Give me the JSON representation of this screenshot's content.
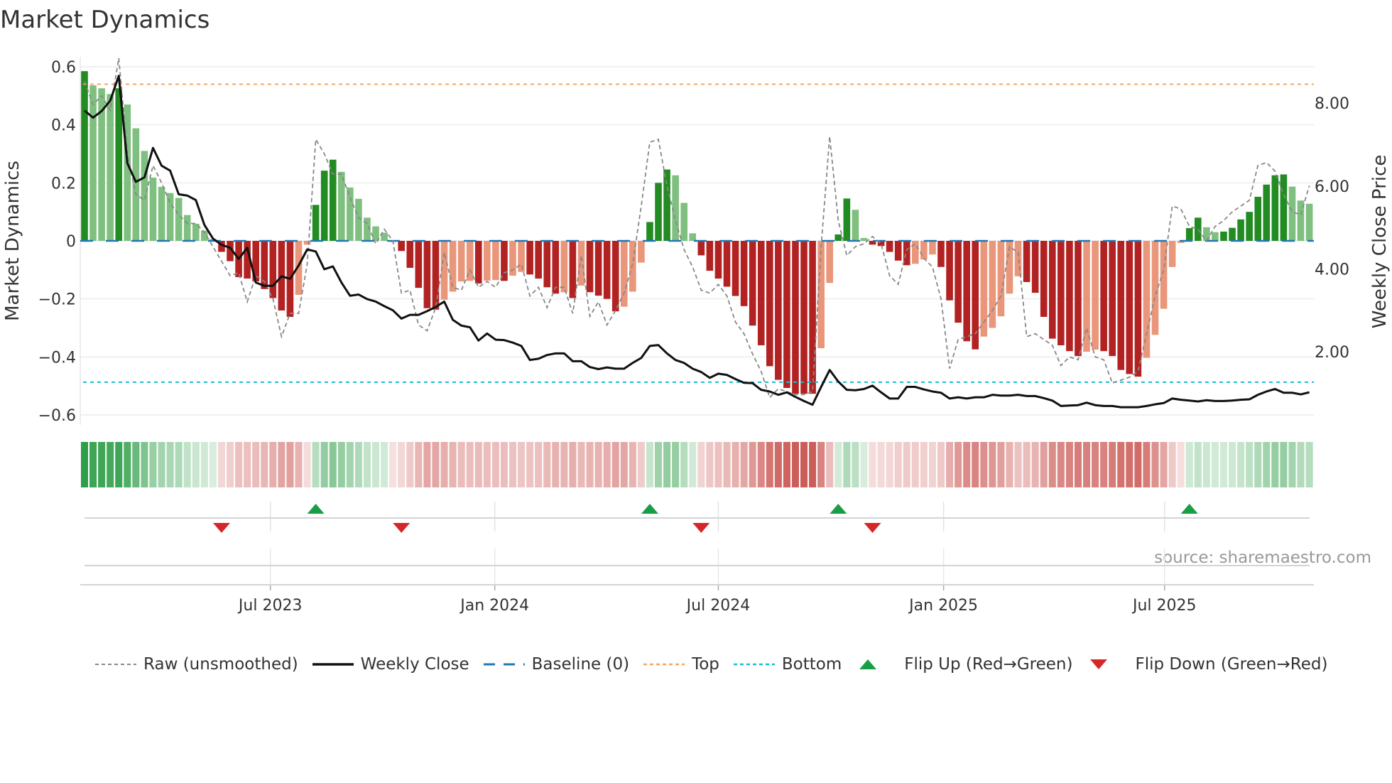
{
  "chart_data": {
    "type": "bar",
    "title": "Market Dynamics",
    "ylabel": "Market Dynamics",
    "y2label": "Weekly Close Price",
    "ylim": [
      -0.62,
      0.62
    ],
    "y2lim": [
      0.0,
      9.3
    ],
    "yticks": [
      {
        "v": 0.6,
        "label": "0.6"
      },
      {
        "v": 0.4,
        "label": "0.4"
      },
      {
        "v": 0.2,
        "label": "0.2"
      },
      {
        "v": 0,
        "label": "0"
      },
      {
        "v": -0.2,
        "label": "−0.2"
      },
      {
        "v": -0.4,
        "label": "−0.4"
      },
      {
        "v": -0.6,
        "label": "−0.6"
      }
    ],
    "y2ticks": [
      {
        "v": 8,
        "label": "8.00"
      },
      {
        "v": 6,
        "label": "6.00"
      },
      {
        "v": 4,
        "label": "4.00"
      },
      {
        "v": 2,
        "label": "2.00"
      }
    ],
    "xticks": [
      {
        "week": 22.7,
        "label": "Jul 2023"
      },
      {
        "week": 48.9,
        "label": "Jan 2024"
      },
      {
        "week": 75.0,
        "label": "Jul 2024"
      },
      {
        "week": 101.3,
        "label": "Jan 2025"
      },
      {
        "week": 127.1,
        "label": "Jul 2025"
      }
    ],
    "grid": true,
    "top_level": 0.54,
    "bottom_level": -0.487,
    "baseline": 0,
    "momentum": [
      0.585,
      0.536,
      0.526,
      0.506,
      0.526,
      0.47,
      0.388,
      0.31,
      0.218,
      0.186,
      0.165,
      0.148,
      0.089,
      0.059,
      0.035,
      0.006,
      -0.038,
      -0.07,
      -0.125,
      -0.13,
      -0.14,
      -0.166,
      -0.197,
      -0.24,
      -0.262,
      -0.186,
      -0.013,
      0.124,
      0.242,
      0.28,
      0.238,
      0.184,
      0.145,
      0.08,
      0.05,
      0.028,
      -0.003,
      -0.035,
      -0.093,
      -0.162,
      -0.232,
      -0.237,
      -0.203,
      -0.175,
      -0.14,
      -0.138,
      -0.147,
      -0.137,
      -0.135,
      -0.138,
      -0.12,
      -0.107,
      -0.116,
      -0.13,
      -0.16,
      -0.182,
      -0.177,
      -0.197,
      -0.154,
      -0.177,
      -0.189,
      -0.2,
      -0.243,
      -0.227,
      -0.175,
      -0.075,
      0.065,
      0.2,
      0.246,
      0.226,
      0.131,
      0.026,
      -0.05,
      -0.103,
      -0.13,
      -0.158,
      -0.19,
      -0.225,
      -0.292,
      -0.36,
      -0.432,
      -0.479,
      -0.507,
      -0.527,
      -0.527,
      -0.527,
      -0.37,
      -0.145,
      0.022,
      0.146,
      0.107,
      0.01,
      -0.013,
      -0.018,
      -0.038,
      -0.068,
      -0.084,
      -0.079,
      -0.064,
      -0.047,
      -0.09,
      -0.205,
      -0.282,
      -0.346,
      -0.374,
      -0.33,
      -0.3,
      -0.26,
      -0.182,
      -0.122,
      -0.142,
      -0.179,
      -0.262,
      -0.337,
      -0.36,
      -0.38,
      -0.397,
      -0.382,
      -0.375,
      -0.38,
      -0.397,
      -0.445,
      -0.459,
      -0.468,
      -0.403,
      -0.324,
      -0.234,
      -0.09,
      -0.007,
      0.044,
      0.08,
      0.047,
      0.03,
      0.032,
      0.045,
      0.074,
      0.1,
      0.152,
      0.194,
      0.226,
      0.229,
      0.187,
      0.139,
      0.128
    ],
    "strong": [
      1,
      0,
      0,
      0,
      1,
      0,
      0,
      0,
      0,
      0,
      0,
      0,
      0,
      0,
      0,
      0,
      1,
      1,
      1,
      1,
      1,
      1,
      1,
      1,
      1,
      0,
      0,
      1,
      1,
      1,
      0,
      0,
      0,
      0,
      0,
      0,
      0,
      1,
      1,
      1,
      1,
      1,
      0,
      0,
      0,
      0,
      1,
      0,
      0,
      1,
      0,
      0,
      1,
      1,
      1,
      1,
      0,
      1,
      0,
      1,
      1,
      1,
      1,
      0,
      0,
      0,
      1,
      1,
      1,
      0,
      0,
      0,
      1,
      1,
      1,
      1,
      1,
      1,
      1,
      1,
      1,
      1,
      1,
      1,
      1,
      1,
      0,
      0,
      1,
      1,
      0,
      0,
      1,
      1,
      1,
      1,
      1,
      0,
      0,
      0,
      1,
      1,
      1,
      1,
      1,
      0,
      0,
      0,
      0,
      0,
      1,
      1,
      1,
      1,
      1,
      1,
      1,
      0,
      0,
      1,
      1,
      1,
      1,
      1,
      0,
      0,
      0,
      0,
      0,
      1,
      1,
      0,
      0,
      1,
      1,
      1,
      1,
      1,
      1,
      1,
      1,
      0,
      0,
      0
    ],
    "raw": [
      0.55,
      0.47,
      0.5,
      0.45,
      0.63,
      0.3,
      0.16,
      0.14,
      0.26,
      0.2,
      0.13,
      0.09,
      0.06,
      0.06,
      0.03,
      -0.02,
      -0.07,
      -0.12,
      -0.11,
      -0.21,
      -0.12,
      -0.14,
      -0.2,
      -0.33,
      -0.25,
      -0.25,
      -0.08,
      0.35,
      0.3,
      0.23,
      0.23,
      0.15,
      0.08,
      0.06,
      -0.01,
      0.04,
      0.0,
      -0.18,
      -0.17,
      -0.29,
      -0.31,
      -0.23,
      -0.04,
      -0.16,
      -0.17,
      -0.1,
      -0.16,
      -0.14,
      -0.16,
      -0.11,
      -0.1,
      -0.08,
      -0.19,
      -0.16,
      -0.23,
      -0.16,
      -0.16,
      -0.25,
      -0.05,
      -0.26,
      -0.21,
      -0.29,
      -0.24,
      -0.18,
      -0.08,
      0.12,
      0.34,
      0.35,
      0.19,
      0.07,
      -0.03,
      -0.09,
      -0.17,
      -0.18,
      -0.15,
      -0.19,
      -0.28,
      -0.32,
      -0.39,
      -0.45,
      -0.54,
      -0.51,
      -0.52,
      -0.53,
      -0.53,
      -0.52,
      -0.02,
      0.36,
      0.07,
      -0.05,
      -0.02,
      -0.01,
      0.015,
      -0.01,
      -0.12,
      -0.15,
      -0.03,
      -0.01,
      -0.06,
      -0.09,
      -0.2,
      -0.44,
      -0.34,
      -0.33,
      -0.32,
      -0.28,
      -0.24,
      -0.19,
      -0.02,
      -0.04,
      -0.33,
      -0.32,
      -0.34,
      -0.36,
      -0.43,
      -0.4,
      -0.41,
      -0.3,
      -0.4,
      -0.41,
      -0.49,
      -0.48,
      -0.47,
      -0.45,
      -0.32,
      -0.19,
      -0.1,
      0.12,
      0.11,
      0.05,
      0.04,
      0.0,
      0.05,
      0.07,
      0.1,
      0.12,
      0.14,
      0.26,
      0.27,
      0.24,
      0.16,
      0.1,
      0.09,
      0.19
    ],
    "weekly_close": [
      7.82,
      7.65,
      7.81,
      8.06,
      8.66,
      6.55,
      6.1,
      6.21,
      6.92,
      6.49,
      6.37,
      5.8,
      5.77,
      5.66,
      5.06,
      4.73,
      4.58,
      4.51,
      4.24,
      4.51,
      3.67,
      3.59,
      3.59,
      3.82,
      3.76,
      4.08,
      4.47,
      4.42,
      3.99,
      4.06,
      3.67,
      3.35,
      3.38,
      3.27,
      3.21,
      3.1,
      3.0,
      2.8,
      2.89,
      2.89,
      2.98,
      3.08,
      3.21,
      2.77,
      2.63,
      2.59,
      2.27,
      2.44,
      2.29,
      2.28,
      2.22,
      2.14,
      1.8,
      1.83,
      1.92,
      1.96,
      1.96,
      1.77,
      1.77,
      1.63,
      1.58,
      1.62,
      1.59,
      1.59,
      1.73,
      1.85,
      2.14,
      2.16,
      1.96,
      1.8,
      1.73,
      1.59,
      1.51,
      1.37,
      1.47,
      1.44,
      1.34,
      1.25,
      1.24,
      1.08,
      1.04,
      0.96,
      1.02,
      0.91,
      0.81,
      0.72,
      1.15,
      1.56,
      1.28,
      1.08,
      1.07,
      1.1,
      1.18,
      1.02,
      0.87,
      0.87,
      1.15,
      1.15,
      1.09,
      1.04,
      1.01,
      0.87,
      0.9,
      0.87,
      0.9,
      0.9,
      0.96,
      0.94,
      0.94,
      0.96,
      0.93,
      0.93,
      0.88,
      0.82,
      0.69,
      0.7,
      0.71,
      0.77,
      0.71,
      0.69,
      0.69,
      0.66,
      0.66,
      0.66,
      0.69,
      0.73,
      0.76,
      0.87,
      0.84,
      0.82,
      0.8,
      0.83,
      0.81,
      0.81,
      0.82,
      0.84,
      0.85,
      0.96,
      1.04,
      1.1,
      1.01,
      1.01,
      0.97,
      1.02
    ],
    "flip_up_weeks": [
      28,
      67,
      89,
      130
    ],
    "flip_down_weeks": [
      17,
      38,
      73,
      93
    ],
    "colors": {
      "strong_green": "#228b22",
      "weak_green": "#7fbf7f",
      "strong_red": "#b22222",
      "weak_red": "#e9967a",
      "raw": "#888888",
      "close": "#111111",
      "baseline": "#1f77b4",
      "top": "#f4a460",
      "bottom": "#17becf",
      "flip_up": "#1a9e45",
      "flip_down": "#d62728",
      "heat_green": "#2e9e48",
      "heat_red": "#c8504c"
    },
    "legend": [
      {
        "key": "raw",
        "label": "Raw (unsmoothed)"
      },
      {
        "key": "close",
        "label": "Weekly Close"
      },
      {
        "key": "baseline",
        "label": "Baseline (0)"
      },
      {
        "key": "top",
        "label": "Top"
      },
      {
        "key": "bottom",
        "label": "Bottom"
      },
      {
        "key": "flip_up",
        "label": "Flip Up (Red→Green)"
      },
      {
        "key": "flip_down",
        "label": "Flip Down (Green→Red)"
      }
    ],
    "legend_position": "bottom",
    "source": "source: sharemaestro.com"
  }
}
